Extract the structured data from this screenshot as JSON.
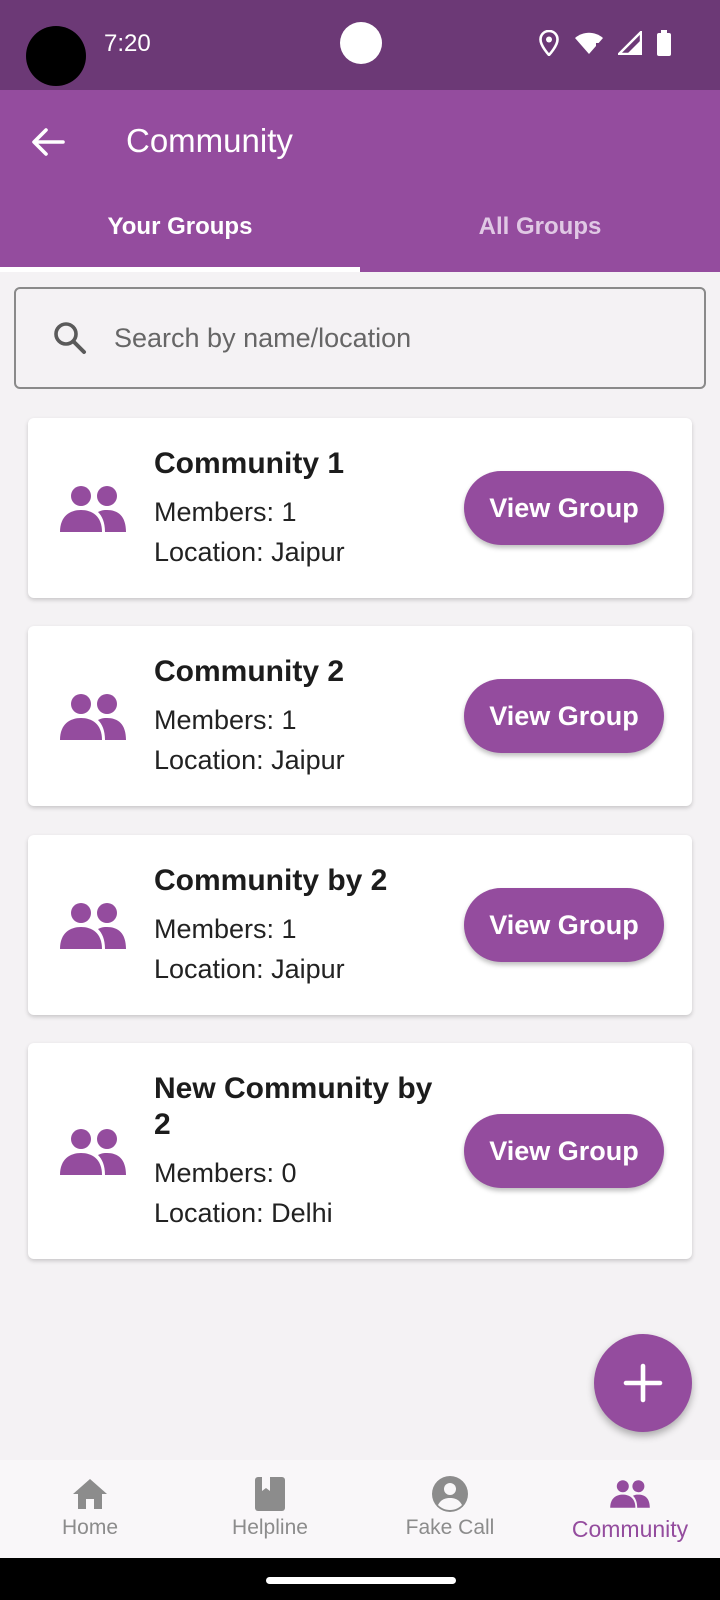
{
  "status_bar": {
    "time": "7:20"
  },
  "app_bar": {
    "title": "Community"
  },
  "tabs": [
    {
      "label": "Your Groups",
      "active": true
    },
    {
      "label": "All Groups",
      "active": false
    }
  ],
  "search": {
    "placeholder": "Search by name/location",
    "value": ""
  },
  "groups": [
    {
      "name": "Community 1",
      "members": "Members: 1",
      "location": "Location: Jaipur",
      "button": "View Group"
    },
    {
      "name": "Community 2",
      "members": "Members: 1",
      "location": "Location: Jaipur",
      "button": "View Group"
    },
    {
      "name": "Community by 2",
      "members": "Members: 1",
      "location": "Location: Jaipur",
      "button": "View Group"
    },
    {
      "name": "New Community by 2",
      "members": "Members: 0",
      "location": "Location: Delhi",
      "button": "View Group"
    }
  ],
  "bottom_nav": [
    {
      "label": "Home",
      "icon": "home-icon",
      "active": false
    },
    {
      "label": "Helpline",
      "icon": "book-icon",
      "active": false
    },
    {
      "label": "Fake Call",
      "icon": "account-circle-icon",
      "active": false
    },
    {
      "label": "Community",
      "icon": "people-icon",
      "active": true
    }
  ],
  "colors": {
    "primary": "#944c9e",
    "status_bar": "#6c3976",
    "background": "#f4f2f4",
    "nav_inactive": "#8c8c8c"
  }
}
